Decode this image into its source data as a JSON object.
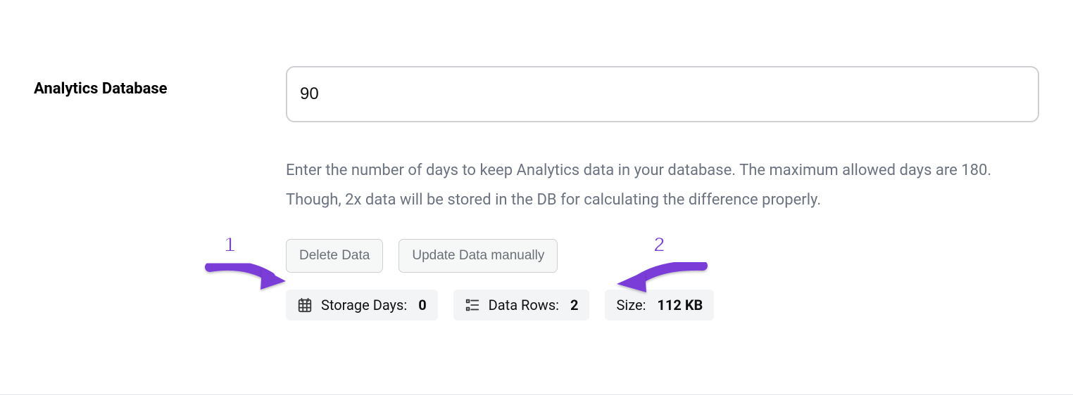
{
  "section": {
    "title": "Analytics Database"
  },
  "input": {
    "value": "90"
  },
  "help_text": "Enter the number of days to keep Analytics data in your database. The maximum allowed days are 180. Though, 2x data will be stored in the DB for calculating the difference properly.",
  "buttons": {
    "delete": "Delete Data",
    "update": "Update Data manually"
  },
  "stats": {
    "storage_days": {
      "label": "Storage Days: ",
      "value": "0"
    },
    "data_rows": {
      "label": "Data Rows: ",
      "value": "2"
    },
    "size": {
      "label": "Size: ",
      "value": "112 KB"
    }
  },
  "annotations": {
    "one": "1",
    "two": "2"
  }
}
